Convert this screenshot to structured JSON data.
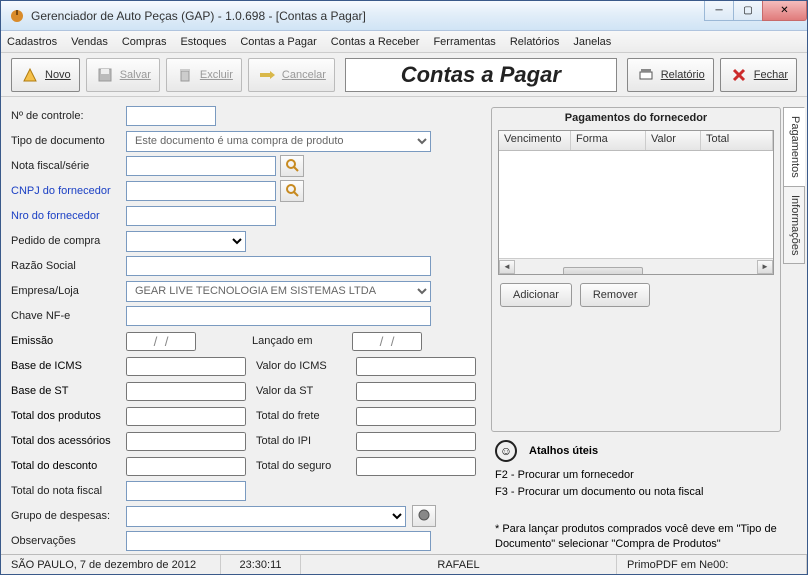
{
  "window": {
    "title": "Gerenciador de Auto Peças (GAP) - 1.0.698 - [Contas a Pagar]"
  },
  "menu": [
    "Cadastros",
    "Vendas",
    "Compras",
    "Estoques",
    "Contas a Pagar",
    "Contas a Receber",
    "Ferramentas",
    "Relatórios",
    "Janelas"
  ],
  "toolbar": {
    "novo": "Novo",
    "salvar": "Salvar",
    "excluir": "Excluir",
    "cancelar": "Cancelar",
    "relatorio": "Relatório",
    "fechar": "Fechar",
    "page_title": "Contas a Pagar"
  },
  "form": {
    "nro_controle_label": "Nº de controle:",
    "tipo_documento_label": "Tipo de documento",
    "tipo_documento_value": "Este documento é uma compra de produto",
    "nota_fiscal_label": "Nota fiscal/série",
    "cnpj_fornecedor_label": "CNPJ do fornecedor",
    "nro_fornecedor_label": "Nro do fornecedor",
    "pedido_compra_label": "Pedido de compra",
    "razao_social_label": "Razão Social",
    "empresa_loja_label": "Empresa/Loja",
    "empresa_loja_value": "GEAR LIVE TECNOLOGIA EM SISTEMAS LTDA",
    "chave_nfe_label": "Chave NF-e",
    "emissao_label": "Emissão",
    "emissao_value": "/  /",
    "lancado_label": "Lançado em",
    "lancado_value": "/  /",
    "base_icms_label": "Base de ICMS",
    "valor_icms_label": "Valor do ICMS",
    "base_st_label": "Base de ST",
    "valor_st_label": "Valor da ST",
    "total_produtos_label": "Total dos produtos",
    "total_frete_label": "Total do frete",
    "total_acessorios_label": "Total dos acessórios",
    "total_ipi_label": "Total do IPI",
    "total_desconto_label": "Total do desconto",
    "total_seguro_label": "Total do seguro",
    "total_nota_label": "Total do nota fiscal",
    "grupo_despesas_label": "Grupo de despesas:",
    "observacoes_label": "Observações"
  },
  "payments": {
    "title": "Pagamentos do fornecedor",
    "cols": {
      "vencimento": "Vencimento",
      "forma": "Forma",
      "valor": "Valor",
      "total": "Total"
    },
    "add": "Adicionar",
    "remove": "Remover"
  },
  "tabs": {
    "pagamentos": "Pagamentos",
    "informacoes": "Informações"
  },
  "shortcuts": {
    "title": "Atalhos úteis",
    "f2": "F2 - Procurar um fornecedor",
    "f3": "F3 - Procurar um documento ou nota fiscal",
    "note": "* Para lançar produtos comprados você deve em \"Tipo de Documento\" selecionar \"Compra de Produtos\""
  },
  "status": {
    "location": "SÃO PAULO, 7 de dezembro de 2012",
    "time": "23:30:11",
    "user": "RAFAEL",
    "printer": "PrimoPDF em Ne00:"
  }
}
